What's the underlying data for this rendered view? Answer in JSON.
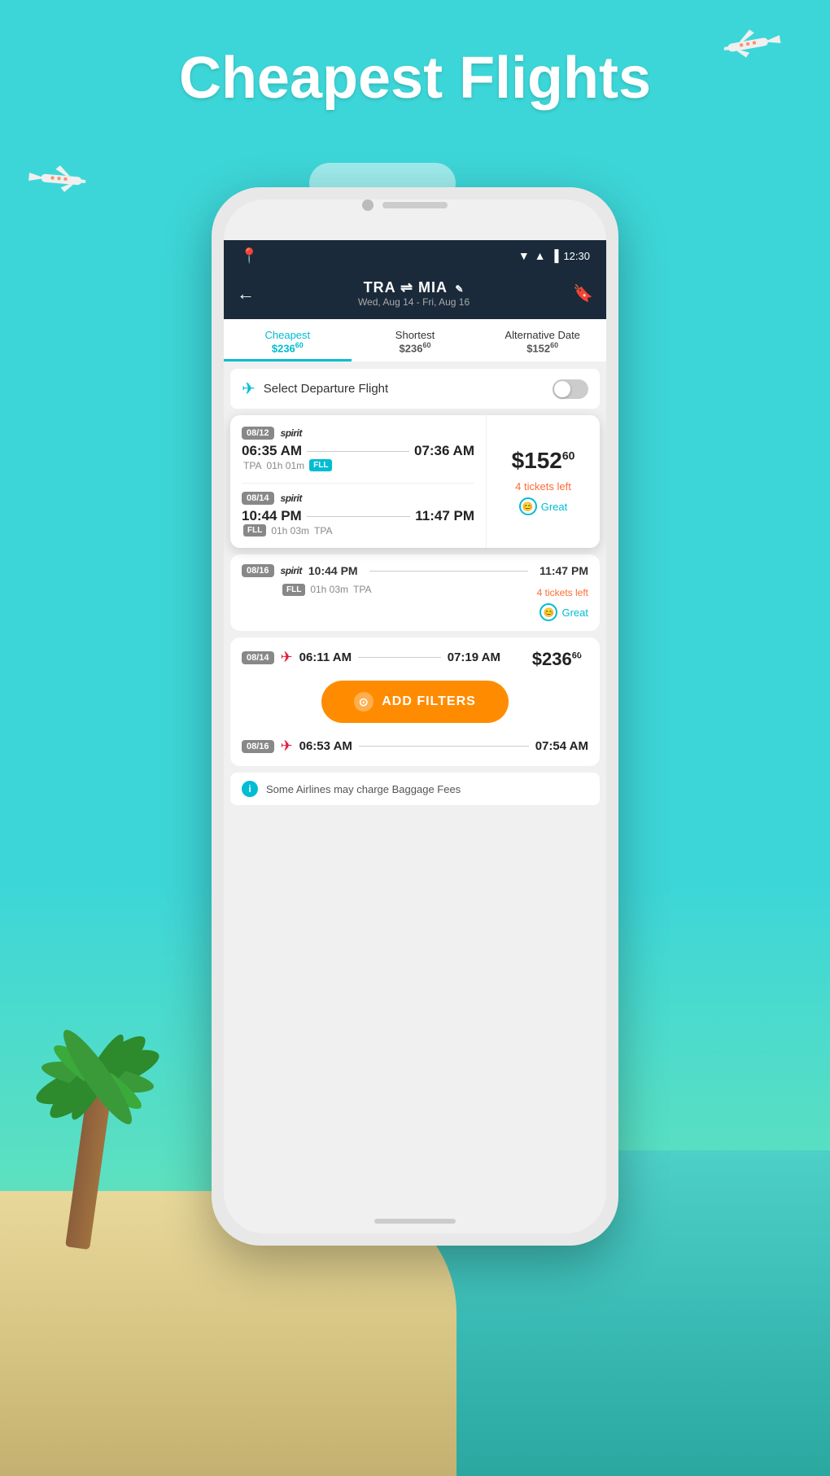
{
  "page": {
    "title": "Cheapest Flights",
    "background_color": "#3dd6d8"
  },
  "header": {
    "route": "TRA ⇌ MIA",
    "route_icon": "✈",
    "date_range": "Wed, Aug 14 - Fri, Aug 16",
    "back_icon": "←",
    "bookmark_icon": "🔖",
    "edit_icon": "✎"
  },
  "status_bar": {
    "time": "12:30",
    "wifi": "▼",
    "signal": "▲",
    "battery": "▐"
  },
  "tabs": [
    {
      "name": "Cheapest",
      "price": "$236",
      "cents": "60",
      "active": true
    },
    {
      "name": "Shortest",
      "price": "$236",
      "cents": "60",
      "active": false
    },
    {
      "name": "Alternative Date",
      "price": "$152",
      "cents": "60",
      "active": false
    }
  ],
  "departure_header": {
    "text": "Select Departure Flight",
    "plane_icon": "✈"
  },
  "featured_card": {
    "price_dollars": "$152",
    "price_cents": "60",
    "tickets_left": "4 tickets left",
    "rating": "Great",
    "flights": [
      {
        "date": "08/12",
        "airline": "spirit",
        "depart_time": "06:35 AM",
        "arrive_time": "07:36 AM",
        "origin": "TPA",
        "destination": "FLL",
        "duration": "01h 01m",
        "dest_badge_color": "teal"
      },
      {
        "date": "08/14",
        "airline": "spirit",
        "depart_time": "10:44 PM",
        "arrive_time": "11:47 PM",
        "origin": "FLL",
        "destination": "TPA",
        "duration": "01h 03m",
        "origin_badge_color": "dark"
      }
    ]
  },
  "small_card": {
    "date": "08/16",
    "airline": "spirit",
    "depart_time": "10:44 PM",
    "arrive_time": "11:47 PM",
    "origin": "FLL",
    "destination": "TPA",
    "duration": "01h 03m",
    "tickets_left": "4 tickets left",
    "rating": "Great"
  },
  "alt_card": {
    "date": "08/14",
    "airline_type": "american",
    "depart_time": "06:11 AM",
    "arrive_time": "07:19 AM",
    "price_dollars": "$236",
    "price_cents": "60",
    "date2": "08/16",
    "airline_type2": "american",
    "depart_time2": "06:53 AM",
    "arrive_time2": "07:54 AM"
  },
  "filters_button": {
    "label": "ADD FILTERS",
    "icon": "⊙"
  },
  "baggage_notice": {
    "text": "Some Airlines may charge Baggage Fees",
    "icon": "i"
  }
}
